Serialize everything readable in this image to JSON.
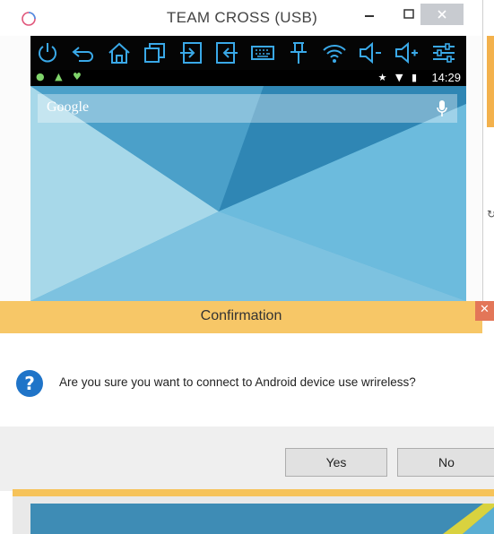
{
  "window": {
    "title": "TEAM CROSS (USB)"
  },
  "toolbar": {
    "icons": [
      "power-icon",
      "back-icon",
      "home-icon",
      "recent-apps-icon",
      "enter-icon",
      "exit-icon",
      "keyboard-icon",
      "pin-icon",
      "wifi-icon",
      "volume-down-icon",
      "volume-up-icon",
      "settings-sliders-icon"
    ]
  },
  "statusbar": {
    "time": "14:29",
    "right_icons": "★ ▼ ▮",
    "left_icons": "● ▲ ♥"
  },
  "device_screen": {
    "search_placeholder": "Google"
  },
  "dialog": {
    "title": "Confirmation",
    "message": "Are you sure you want to connect to Android device use wrireless?",
    "yes_label": "Yes",
    "no_label": "No",
    "close_glyph": "✕"
  },
  "colors": {
    "accent_orange": "#f7c767",
    "close_red": "#e37658",
    "toolbar_icon": "#3aa9e8",
    "question_blue": "#1f74c8"
  }
}
